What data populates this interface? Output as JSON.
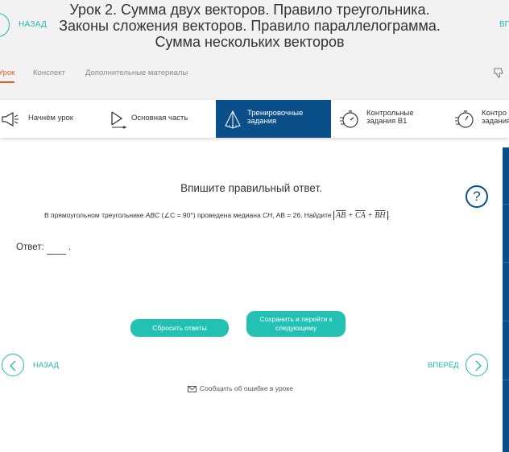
{
  "header": {
    "back_label": "НАЗАД",
    "forward_label": "ВП",
    "title_line1": "Урок 2. Сумма двух векторов. Правило треугольника.",
    "title_line2": "Законы сложения векторов. Правило параллелограмма.",
    "title_line3": "Сумма нескольких векторов",
    "tabs": [
      {
        "label": "Урок",
        "active": true
      },
      {
        "label": "Конспект",
        "active": false
      },
      {
        "label": "Дополнительные материалы",
        "active": false
      }
    ]
  },
  "steps": [
    {
      "line1": "Начнём урок",
      "line2": "",
      "icon": "megaphone-icon",
      "active": false
    },
    {
      "line1": "Основная часть",
      "line2": "",
      "icon": "play-icon",
      "active": false
    },
    {
      "line1": "Тренировочные",
      "line2": "задания",
      "icon": "pyramid-icon",
      "active": true
    },
    {
      "line1": "Контрольные",
      "line2": "задания В1",
      "icon": "stopwatch-icon",
      "active": false
    },
    {
      "line1": "Контро",
      "line2": "задания",
      "icon": "stopwatch-icon",
      "active": false
    }
  ],
  "content": {
    "prompt": "Впишите правильный ответ.",
    "task_text_before": "В прямоугольном треугольнике ",
    "task_abc": "ABC",
    "task_angle": "(∠C = 90°)",
    "task_middle": " проведена медиана ",
    "task_ch": "CH",
    "task_ab": ", AB = 26. Найдите ",
    "vec1": "AB",
    "plus1": " + ",
    "vec2": "CA",
    "plus2": " + ",
    "vec3": "BH",
    "task_end": ".",
    "answer_label": "Ответ:",
    "answer_value": "",
    "answer_dot": "."
  },
  "buttons": {
    "reset": "Сбросить ответы",
    "save_line1": "Сохранить и перейти к",
    "save_line2": "следующему"
  },
  "nav": {
    "back": "НАЗАД",
    "forward": "ВПЕРЁД"
  },
  "report": "Сообщить об ошибке в уроке",
  "colors": {
    "accent": "#22c1b3",
    "active_step": "#0b4f8a",
    "active_tab": "#e05a2b"
  }
}
